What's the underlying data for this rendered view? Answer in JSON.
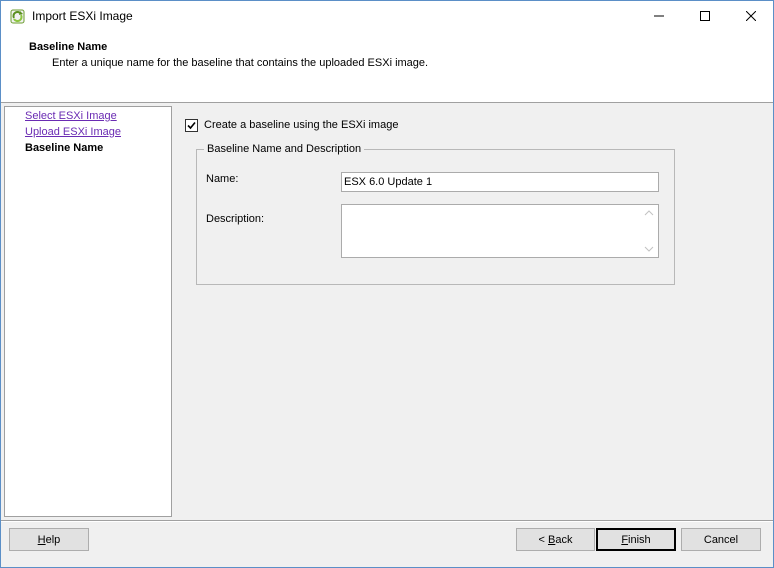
{
  "window": {
    "title": "Import ESXi Image",
    "icon": "vmware-update-icon",
    "controls": [
      "minimize-icon",
      "maximize-icon",
      "close-icon"
    ]
  },
  "header": {
    "title": "Baseline Name",
    "subtitle": "Enter a unique name for the baseline that contains the uploaded ESXi image."
  },
  "steps": [
    {
      "label": "Select ESXi Image",
      "state": "link"
    },
    {
      "label": "Upload ESXi Image",
      "state": "link"
    },
    {
      "label": "Baseline Name",
      "state": "current"
    }
  ],
  "main": {
    "create_baseline_checkbox": {
      "label": "Create a baseline using the ESXi image",
      "checked": true
    },
    "group": {
      "legend": "Baseline Name and Description",
      "name_label": "Name:",
      "name_value": "ESX 6.0 Update 1",
      "description_label": "Description:",
      "description_value": ""
    }
  },
  "footer": {
    "help": {
      "prefix": "",
      "mnemonic": "H",
      "rest": "elp"
    },
    "back": {
      "prefix": "< ",
      "mnemonic": "B",
      "rest": "ack"
    },
    "finish": {
      "prefix": "",
      "mnemonic": "F",
      "rest": "inish"
    },
    "cancel": {
      "prefix": "",
      "mnemonic": "",
      "rest": "Cancel"
    }
  },
  "colors": {
    "link": "#6a2bb3",
    "window_border": "#5b8fc7",
    "dialog_bg": "#f0f0f0"
  }
}
